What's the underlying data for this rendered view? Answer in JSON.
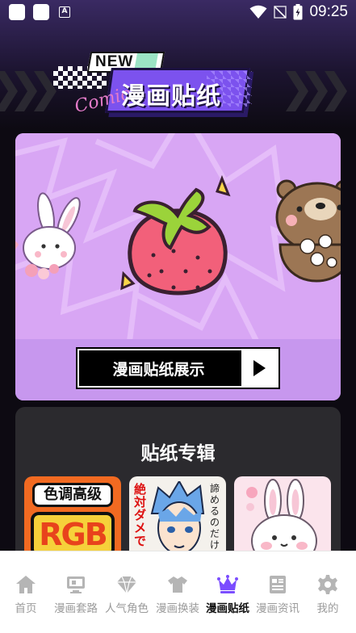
{
  "status_bar": {
    "time": "09:25",
    "left_icons": [
      "app-square-icon",
      "app-square-icon",
      "a-letter-icon"
    ],
    "a_glyph": "A",
    "right_icons": [
      "wifi-icon",
      "no-signal-icon",
      "battery-charging-icon"
    ]
  },
  "header": {
    "badge": "NEW",
    "decor_word": "Comic",
    "title": "漫画贴纸"
  },
  "showcase": {
    "button_label": "漫画贴纸展示",
    "play_icon": "play-icon",
    "colors": {
      "card": "#d8a6f4",
      "band": "#c797ee"
    }
  },
  "album": {
    "title": "贴纸专辑",
    "thumbnails": [
      {
        "name": "rgb-sticker-thumb",
        "text": "RGB",
        "caption": "色调高级"
      },
      {
        "name": "anime-boy-thumb",
        "text": "諦めるのだけは",
        "caption": "絶対ダメで"
      },
      {
        "name": "bunny-thumb"
      }
    ]
  },
  "nav": {
    "items": [
      {
        "key": "home",
        "label": "首页",
        "icon": "home-icon"
      },
      {
        "key": "sets",
        "label": "漫画套路",
        "icon": "monitor-icon"
      },
      {
        "key": "characters",
        "label": "人气角色",
        "icon": "diamond-icon"
      },
      {
        "key": "outfits",
        "label": "漫画换装",
        "icon": "shirt-icon"
      },
      {
        "key": "stickers",
        "label": "漫画贴纸",
        "icon": "crown-icon",
        "active": true
      },
      {
        "key": "news",
        "label": "漫画资讯",
        "icon": "article-icon"
      },
      {
        "key": "mine",
        "label": "我的",
        "icon": "gear-icon"
      }
    ],
    "active_color": "#7b4dff",
    "inactive_color": "#b5b5b5"
  }
}
